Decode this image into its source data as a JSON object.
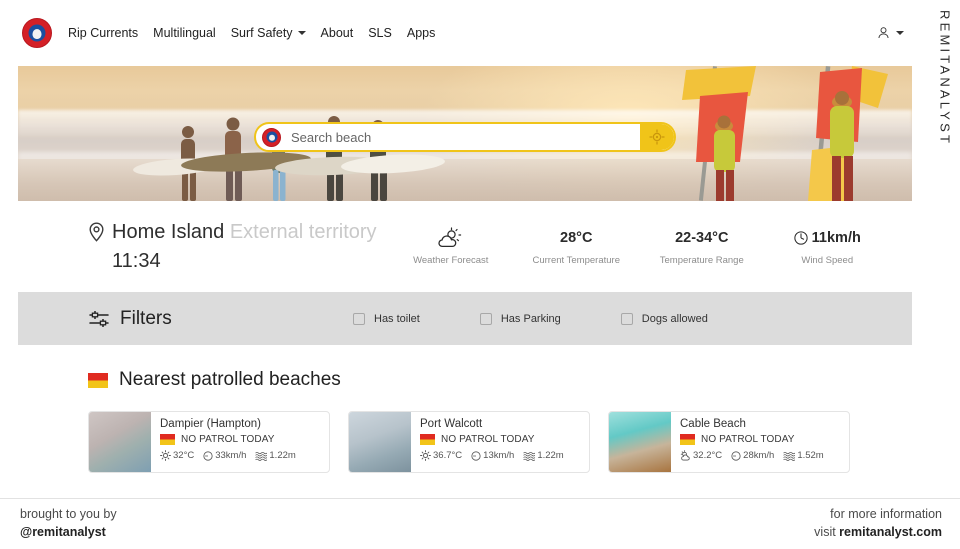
{
  "brand": {
    "vertical_text": "REMITANALYST"
  },
  "navbar": {
    "logo_name": "surf-life-saving-logo",
    "links": [
      {
        "label": "Rip Currents",
        "caret": false
      },
      {
        "label": "Multilingual",
        "caret": false
      },
      {
        "label": "Surf Safety",
        "caret": true
      },
      {
        "label": "About",
        "caret": false
      },
      {
        "label": "SLS",
        "caret": false
      },
      {
        "label": "Apps",
        "caret": false
      }
    ],
    "account_icon": "user-icon"
  },
  "hero": {
    "search": {
      "placeholder": "Search beach",
      "value": "",
      "locate_icon": "crosshair-target-icon",
      "accent_color": "#f0c419"
    }
  },
  "location": {
    "pin_icon": "map-pin-icon",
    "name": "Home Island",
    "region": "External territory",
    "time": "11:34"
  },
  "stats": [
    {
      "icon": "partly-cloudy-sun-icon",
      "value": "",
      "label": "Weather Forecast"
    },
    {
      "icon": "",
      "value": "28°C",
      "label": "Current Temperature"
    },
    {
      "icon": "",
      "value": "22-34°C",
      "label": "Temperature Range"
    },
    {
      "icon": "wind-compass-icon",
      "value": "11km/h",
      "label": "Wind Speed"
    }
  ],
  "filters": {
    "icon": "sliders-icon",
    "title": "Filters",
    "checkboxes": [
      {
        "label": "Has toilet",
        "checked": false
      },
      {
        "label": "Has Parking",
        "checked": false
      },
      {
        "label": "Dogs allowed",
        "checked": false
      }
    ]
  },
  "beaches": {
    "flag_icon": "red-yellow-flag-icon",
    "title": "Nearest patrolled beaches",
    "cards": [
      {
        "thumb": "aerial-coast-photo",
        "name": "Dampier (Hampton)",
        "status": "NO PATROL TODAY",
        "temp": "32°C",
        "wind": "33km/h",
        "swell": "1.22m"
      },
      {
        "thumb": "aerial-estuary-photo",
        "name": "Port Walcott",
        "status": "NO PATROL TODAY",
        "temp": "36.7°C",
        "wind": "13km/h",
        "swell": "1.22m"
      },
      {
        "thumb": "turquoise-lagoon-photo",
        "name": "Cable Beach",
        "status": "NO PATROL TODAY",
        "temp": "32.2°C",
        "wind": "28km/h",
        "swell": "1.52m"
      }
    ]
  },
  "footer": {
    "left_line1": "brought to you by",
    "left_line2": "@remitanalyst",
    "right_line1": "for more information",
    "right_line2_prefix": "visit ",
    "right_line2_strong": "remitanalyst.com"
  }
}
